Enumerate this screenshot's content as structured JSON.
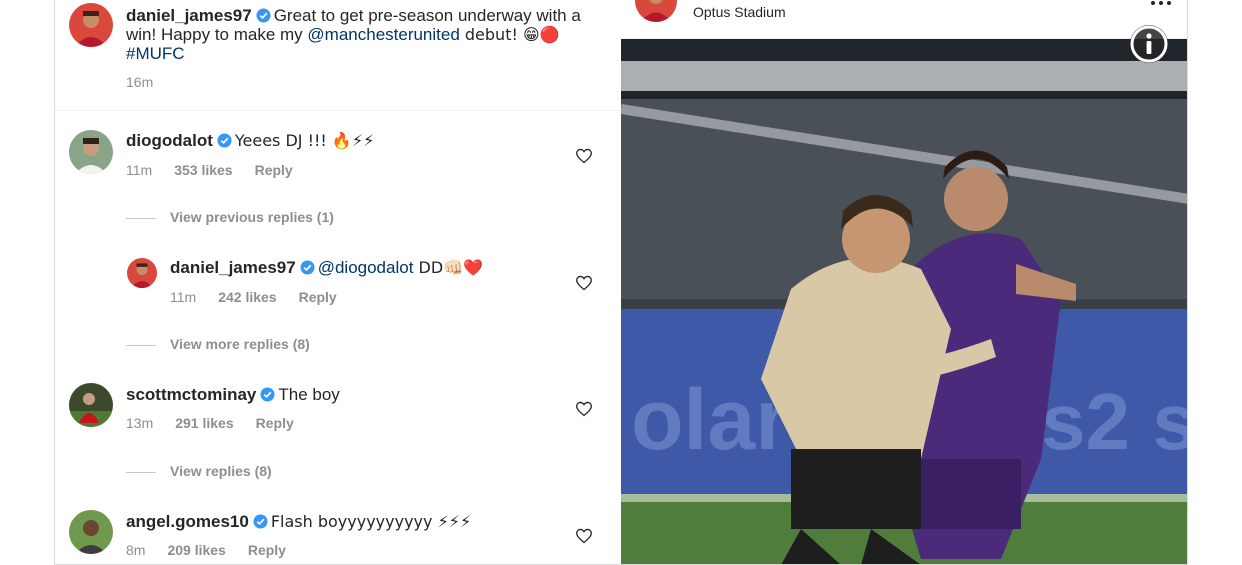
{
  "caption": {
    "username": "daniel_james97",
    "text_line1": "Great to get pre-season underway with a",
    "text_line2_pre": "win! Happy to make my ",
    "mention": "@manchesterunited",
    "text_line2_post": " debut! 😁🔴",
    "hashtag": "#MUFC",
    "time": "16m"
  },
  "comments": [
    {
      "username": "diogodalot",
      "text": "Yeees DJ !!! 🔥⚡⚡",
      "time": "11m",
      "likes": "353 likes",
      "reply": "Reply"
    },
    {
      "username": "scottmctominay",
      "text": "The boy",
      "time": "13m",
      "likes": "291 likes",
      "reply": "Reply"
    },
    {
      "username": "angel.gomes10",
      "text": "Flash boyyyyyyyyyy ⚡⚡⚡",
      "time": "8m",
      "likes": "209 likes",
      "reply": "Reply"
    }
  ],
  "view_previous_replies": "View previous replies (1)",
  "reply": {
    "username": "daniel_james97",
    "mention": "@diogodalot",
    "text": " DD👊🏻❤️",
    "time": "11m",
    "likes": "242 likes",
    "reply": "Reply"
  },
  "view_more_replies": "View more replies (8)",
  "view_replies": "View replies (8)",
  "photo": {
    "location": "Optus Stadium"
  },
  "colors": {
    "verified": "#3897f0",
    "mention": "#003569",
    "meta": "#8e8e8e"
  }
}
